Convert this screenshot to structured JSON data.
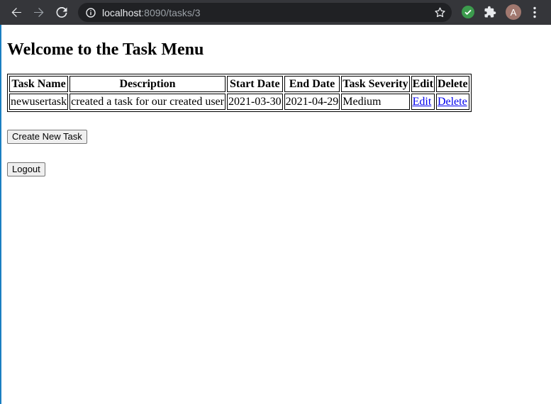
{
  "browser": {
    "url_host": "localhost",
    "url_path": ":8090/tasks/3",
    "avatar_letter": "A"
  },
  "page": {
    "heading": "Welcome to the Task Menu",
    "table": {
      "headers": [
        "Task Name",
        "Description",
        "Start Date",
        "End Date",
        "Task Severity",
        "Edit",
        "Delete"
      ],
      "rows": [
        {
          "task_name": "newusertask",
          "description": "created a task for our created user",
          "start_date": "2021-03-30",
          "end_date": "2021-04-29",
          "severity": "Medium",
          "edit_label": "Edit",
          "delete_label": "Delete"
        }
      ]
    },
    "create_button": "Create New Task",
    "logout_button": "Logout"
  },
  "colors": {
    "toolbar": "#35363a",
    "omnibox": "#202124",
    "link": "#0000ee",
    "extension_green": "#3c9b4d",
    "avatar": "#a1786f"
  },
  "icons": [
    "back-icon",
    "forward-icon",
    "reload-icon",
    "info-icon",
    "star-icon",
    "extension-check-icon",
    "puzzle-icon",
    "menu-icon"
  ]
}
